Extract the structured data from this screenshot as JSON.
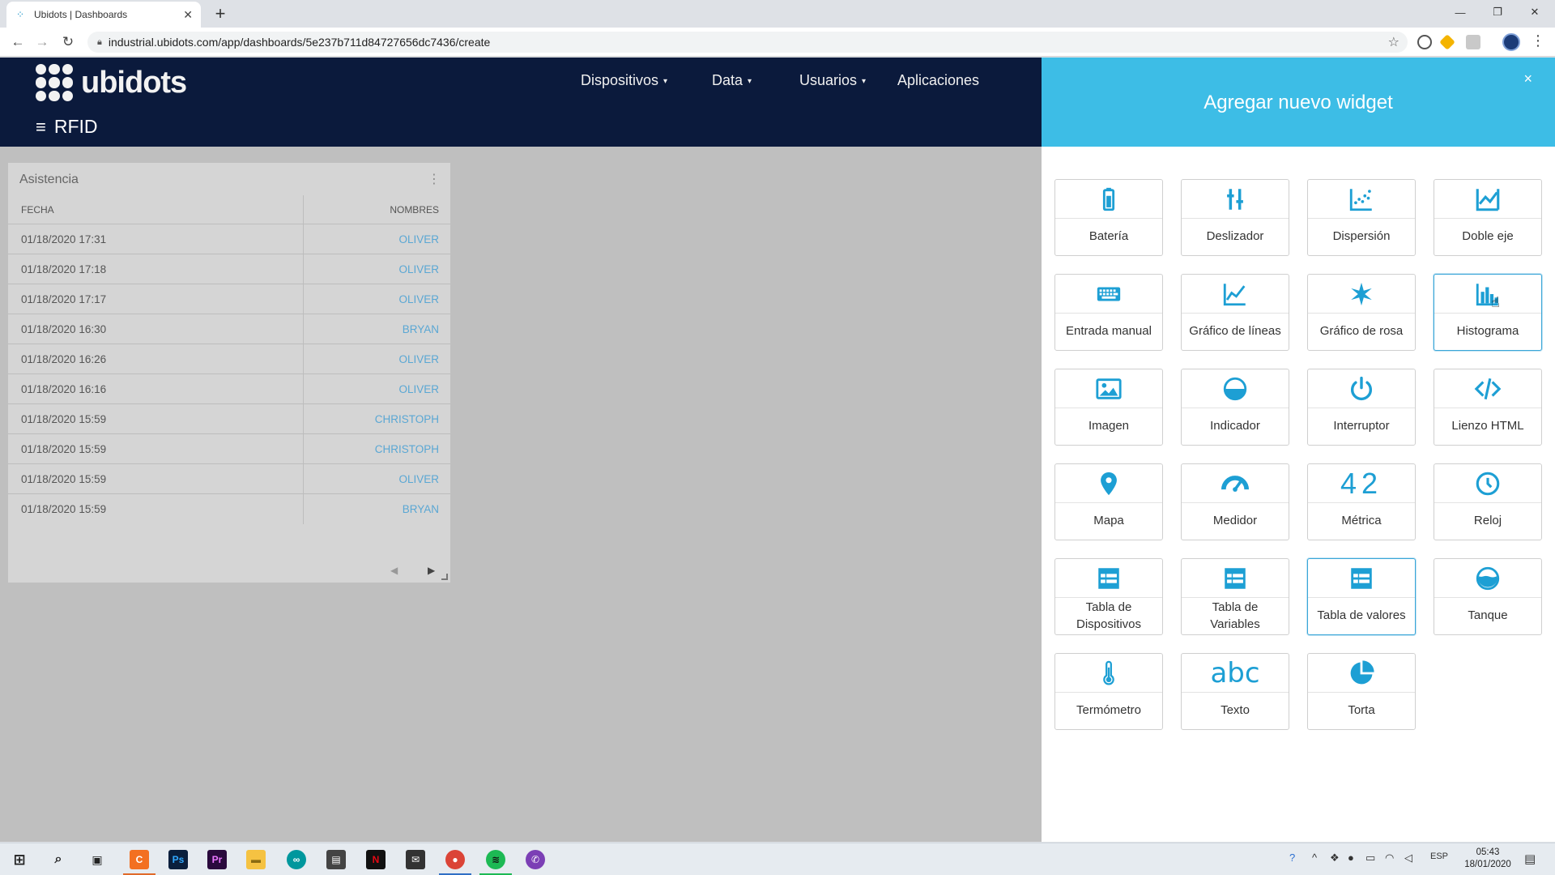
{
  "browser": {
    "tab_title": "Ubidots | Dashboards",
    "tab_close": "✕",
    "new_tab": "+",
    "url": "industrial.ubidots.com/app/dashboards/5e237b711d84727656dc7436/create",
    "window_controls": {
      "minimize": "—",
      "restore": "❐",
      "close": "✕"
    }
  },
  "app": {
    "logo_text": "ubidots",
    "nav": [
      {
        "label": "Dispositivos",
        "caret": "▾"
      },
      {
        "label": "Data",
        "caret": "▾"
      },
      {
        "label": "Usuarios",
        "caret": "▾"
      },
      {
        "label": "Aplicaciones",
        "caret": ""
      }
    ],
    "dashboard_menu_icon": "≡",
    "dashboard_name": "RFID"
  },
  "widget": {
    "title": "Asistencia",
    "menu_icon": "⋮",
    "columns": [
      "FECHA",
      "NOMBRES"
    ],
    "rows": [
      [
        "01/18/2020 17:31",
        "OLIVER"
      ],
      [
        "01/18/2020 17:18",
        "OLIVER"
      ],
      [
        "01/18/2020 17:17",
        "OLIVER"
      ],
      [
        "01/18/2020 16:30",
        "BRYAN"
      ],
      [
        "01/18/2020 16:26",
        "OLIVER"
      ],
      [
        "01/18/2020 16:16",
        "OLIVER"
      ],
      [
        "01/18/2020 15:59",
        "CHRISTOPH"
      ],
      [
        "01/18/2020 15:59",
        "CHRISTOPH"
      ],
      [
        "01/18/2020 15:59",
        "OLIVER"
      ],
      [
        "01/18/2020 15:59",
        "BRYAN"
      ]
    ],
    "pager_prev": "◀",
    "pager_next": "▶"
  },
  "drawer": {
    "title": "Agregar nuevo widget",
    "close": "×",
    "widgets": [
      {
        "label": "Batería",
        "icon": "battery-icon"
      },
      {
        "label": "Deslizador",
        "icon": "slider-icon"
      },
      {
        "label": "Dispersión",
        "icon": "scatter-icon"
      },
      {
        "label": "Doble eje",
        "icon": "double-axis-icon"
      },
      {
        "label": "Entrada manual",
        "icon": "keyboard-icon"
      },
      {
        "label": "Gráfico de líneas",
        "icon": "line-chart-icon"
      },
      {
        "label": "Gráfico de rosa",
        "icon": "rose-chart-icon"
      },
      {
        "label": "Histograma",
        "icon": "histogram-icon"
      },
      {
        "label": "Imagen",
        "icon": "image-icon"
      },
      {
        "label": "Indicador",
        "icon": "indicator-icon"
      },
      {
        "label": "Interruptor",
        "icon": "power-icon"
      },
      {
        "label": "Lienzo HTML",
        "icon": "code-icon"
      },
      {
        "label": "Mapa",
        "icon": "map-pin-icon"
      },
      {
        "label": "Medidor",
        "icon": "gauge-icon"
      },
      {
        "label": "Métrica",
        "icon": "metric-icon",
        "glyph": "42"
      },
      {
        "label": "Reloj",
        "icon": "clock-icon"
      },
      {
        "label": "Tabla de Dispositivos",
        "icon": "table-icon"
      },
      {
        "label": "Tabla de Variables",
        "icon": "table-icon"
      },
      {
        "label": "Tabla de valores",
        "icon": "table-icon"
      },
      {
        "label": "Tanque",
        "icon": "tank-icon"
      },
      {
        "label": "Termómetro",
        "icon": "thermometer-icon"
      },
      {
        "label": "Texto",
        "icon": "text-icon",
        "glyph": "abc"
      },
      {
        "label": "Torta",
        "icon": "pie-icon"
      }
    ]
  },
  "taskbar": {
    "language": "ESP",
    "time": "05:43",
    "date": "18/01/2020"
  },
  "colors": {
    "header_navy": "#0b1a3c",
    "drawer_cyan": "#3dbde6",
    "icon_blue": "#1d9fd4",
    "link_blue": "#5aa7d4"
  }
}
